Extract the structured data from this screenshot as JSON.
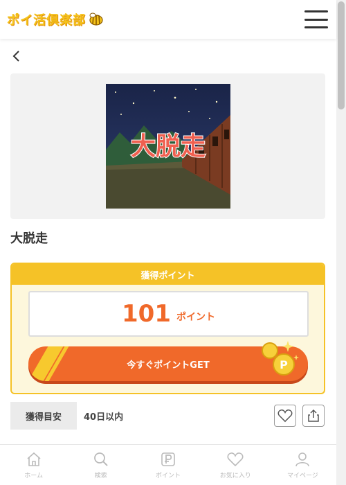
{
  "header": {
    "logo_text": "ポイ活倶楽部"
  },
  "offer": {
    "thumbnail_text": "大脱走",
    "title": "大脱走"
  },
  "points": {
    "heading": "獲得ポイント",
    "value": "101",
    "unit": "ポイント",
    "button_label": "今すぐポイントGET"
  },
  "estimate": {
    "label": "獲得目安",
    "value": "40日以内"
  },
  "nav": [
    {
      "label": "ホーム",
      "icon": "home-icon"
    },
    {
      "label": "検索",
      "icon": "search-icon"
    },
    {
      "label": "ポイント",
      "icon": "point-icon"
    },
    {
      "label": "お気に入り",
      "icon": "heart-icon"
    },
    {
      "label": "マイページ",
      "icon": "user-icon"
    }
  ],
  "colors": {
    "accent": "#f0692a",
    "yellow": "#f5c227",
    "panel": "#fdf7dc"
  }
}
